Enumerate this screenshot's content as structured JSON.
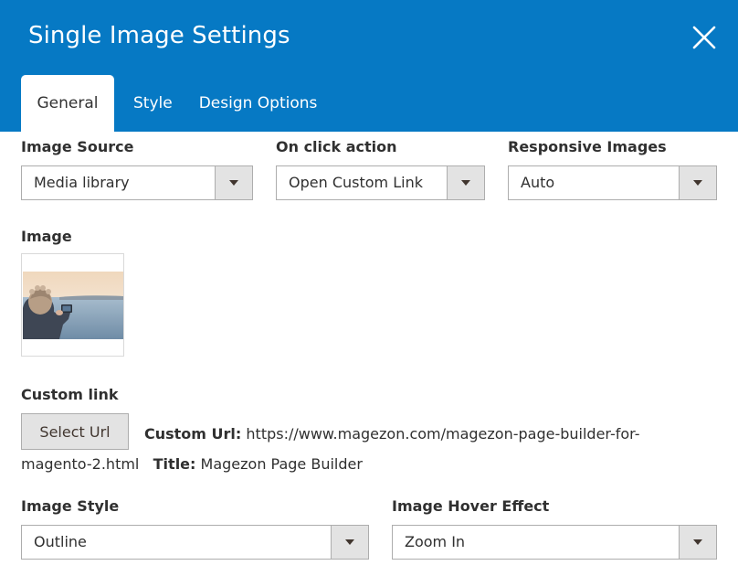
{
  "dialog": {
    "title": "Single Image Settings",
    "close_icon": "close-icon"
  },
  "tabs": [
    {
      "label": "General",
      "active": true
    },
    {
      "label": "Style",
      "active": false
    },
    {
      "label": "Design Options",
      "active": false
    }
  ],
  "fields": {
    "image_source": {
      "label": "Image Source",
      "value": "Media library"
    },
    "on_click_action": {
      "label": "On click action",
      "value": "Open Custom Link"
    },
    "responsive_images": {
      "label": "Responsive Images",
      "value": "Auto"
    },
    "image": {
      "label": "Image"
    },
    "custom_link": {
      "label": "Custom link",
      "button_label": "Select Url",
      "url_label": "Custom Url:",
      "url_value": "https://www.magezon.com/magezon-page-builder-for-magento-2.html",
      "title_label": "Title:",
      "title_value": "Magezon Page Builder"
    },
    "image_style": {
      "label": "Image Style",
      "value": "Outline"
    },
    "image_hover_effect": {
      "label": "Image Hover Effect",
      "value": "Zoom In"
    }
  },
  "colors": {
    "header_bg": "#0679c4",
    "text": "#303030",
    "border": "#adadad",
    "button_bg": "#e3e3e3"
  },
  "icons": {
    "dropdown": "chevron-down-icon",
    "close": "close-icon"
  }
}
